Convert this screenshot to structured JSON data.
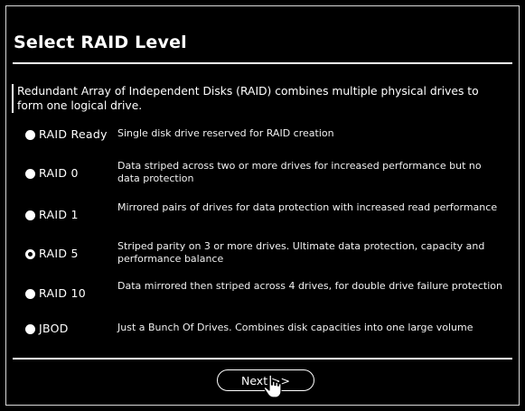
{
  "dialog": {
    "title": "Select RAID Level",
    "intro": "Redundant Array of Independent Disks (RAID) combines multiple physical drives to form one logical drive."
  },
  "options": [
    {
      "label": "RAID Ready",
      "description": "Single disk drive reserved for RAID creation",
      "selected": false
    },
    {
      "label": "RAID 0",
      "description": "Data striped across two or more drives for increased performance but no data protection",
      "selected": false
    },
    {
      "label": "RAID 1",
      "description": "Mirrored pairs of drives for data protection with increased read performance",
      "selected": false
    },
    {
      "label": "RAID 5",
      "description": "Striped parity on 3 or more drives. Ultimate data protection, capacity and performance balance",
      "selected": true
    },
    {
      "label": "RAID 10",
      "description": "Data mirrored then striped across 4 drives, for double drive failure protection",
      "selected": false
    },
    {
      "label": "JBOD",
      "description": "Just a Bunch Of Drives. Combines disk capacities into one large volume",
      "selected": false
    }
  ],
  "next_button": {
    "label": "Next >>"
  },
  "icons": {
    "cursor": "hand-pointer-icon"
  },
  "colors": {
    "background": "#000000",
    "foreground": "#ffffff"
  }
}
